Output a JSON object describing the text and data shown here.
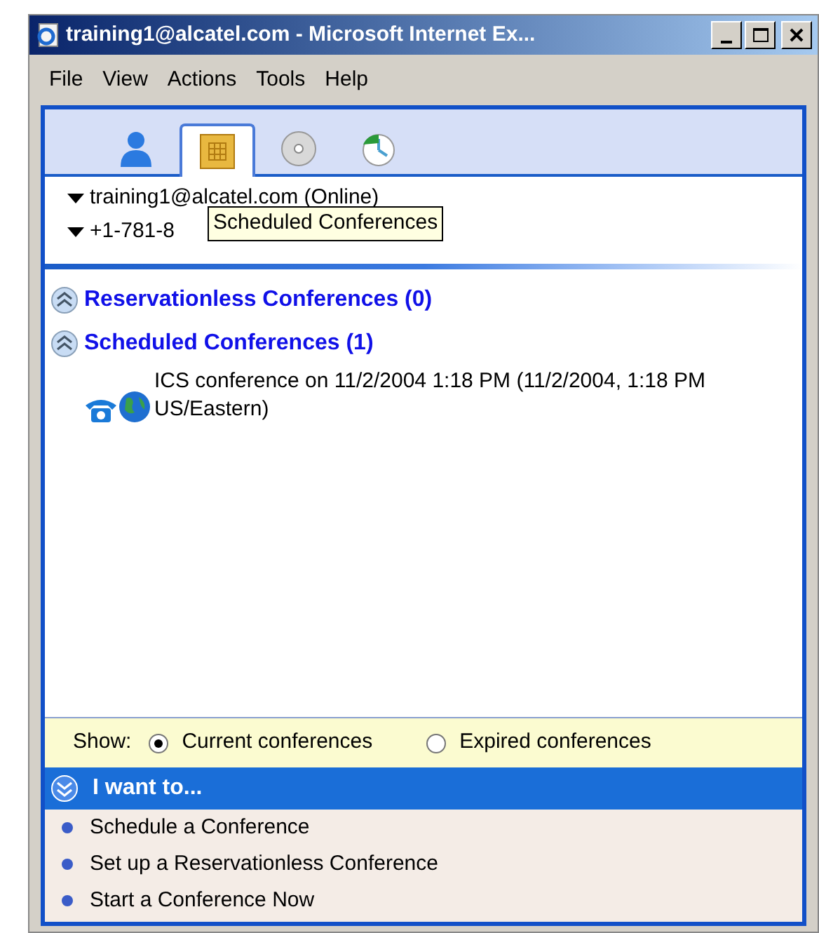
{
  "window": {
    "title": "training1@alcatel.com - Microsoft Internet Ex..."
  },
  "menu": [
    "File",
    "View",
    "Actions",
    "Tools",
    "Help"
  ],
  "tabs": [
    {
      "kind": "person",
      "selected": false
    },
    {
      "kind": "calendar",
      "selected": true
    },
    {
      "kind": "disc",
      "selected": false
    },
    {
      "kind": "clock",
      "selected": false
    }
  ],
  "tree": [
    {
      "label": "training1@alcatel.com (Online)",
      "expanded": true
    },
    {
      "label": "+1-781-8",
      "expanded": true
    }
  ],
  "tooltip": "Scheduled Conferences",
  "sections": [
    {
      "title": "Reservationless Conferences (0)",
      "expanded": true
    },
    {
      "title": "Scheduled Conferences (1)",
      "expanded": true,
      "items": [
        {
          "label": "ICS conference on 11/2/2004 1:18 PM (11/2/2004, 1:18 PM US/Eastern)"
        }
      ]
    }
  ],
  "show": {
    "label": "Show:",
    "options": [
      {
        "label": "Current conferences",
        "selected": true
      },
      {
        "label": "Expired conferences",
        "selected": false
      }
    ]
  },
  "tasks": {
    "title": "I want to...",
    "expanded": true,
    "items": [
      "Schedule a Conference",
      "Set up a Reservationless Conference",
      "Start a Conference Now"
    ]
  }
}
